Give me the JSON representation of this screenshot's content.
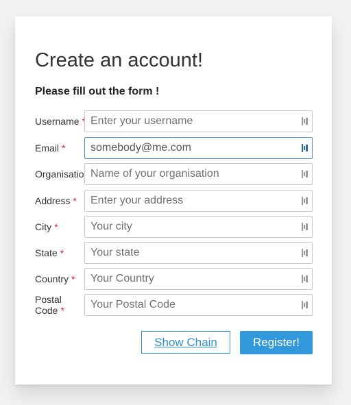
{
  "form": {
    "title": "Create an account!",
    "subtitle": "Please fill out the form !",
    "required_marker": "*",
    "fields": {
      "username": {
        "label": "Username",
        "value": "",
        "placeholder": "Enter your username"
      },
      "email": {
        "label": "Email",
        "value": "somebody@me.com",
        "placeholder": ""
      },
      "organisation": {
        "label": "Organisation",
        "value": "",
        "placeholder": "Name of your organisation"
      },
      "address": {
        "label": "Address",
        "value": "",
        "placeholder": "Enter your address"
      },
      "city": {
        "label": "City",
        "value": "",
        "placeholder": "Your city"
      },
      "state": {
        "label": "State",
        "value": "",
        "placeholder": "Your state"
      },
      "country": {
        "label": "Country",
        "value": "",
        "placeholder": "Your Country"
      },
      "postal_code": {
        "label": "Postal Code",
        "value": "",
        "placeholder": "Your Postal Code"
      }
    },
    "show_chain_label": "Show Chain",
    "register_label": "Register!"
  },
  "icons": {
    "field_icon": "keychain-icon"
  },
  "colors": {
    "accent": "#3399dd",
    "required": "#d9252a",
    "icon_inactive": "#9a9a9a",
    "icon_active": "#2a6e95"
  }
}
